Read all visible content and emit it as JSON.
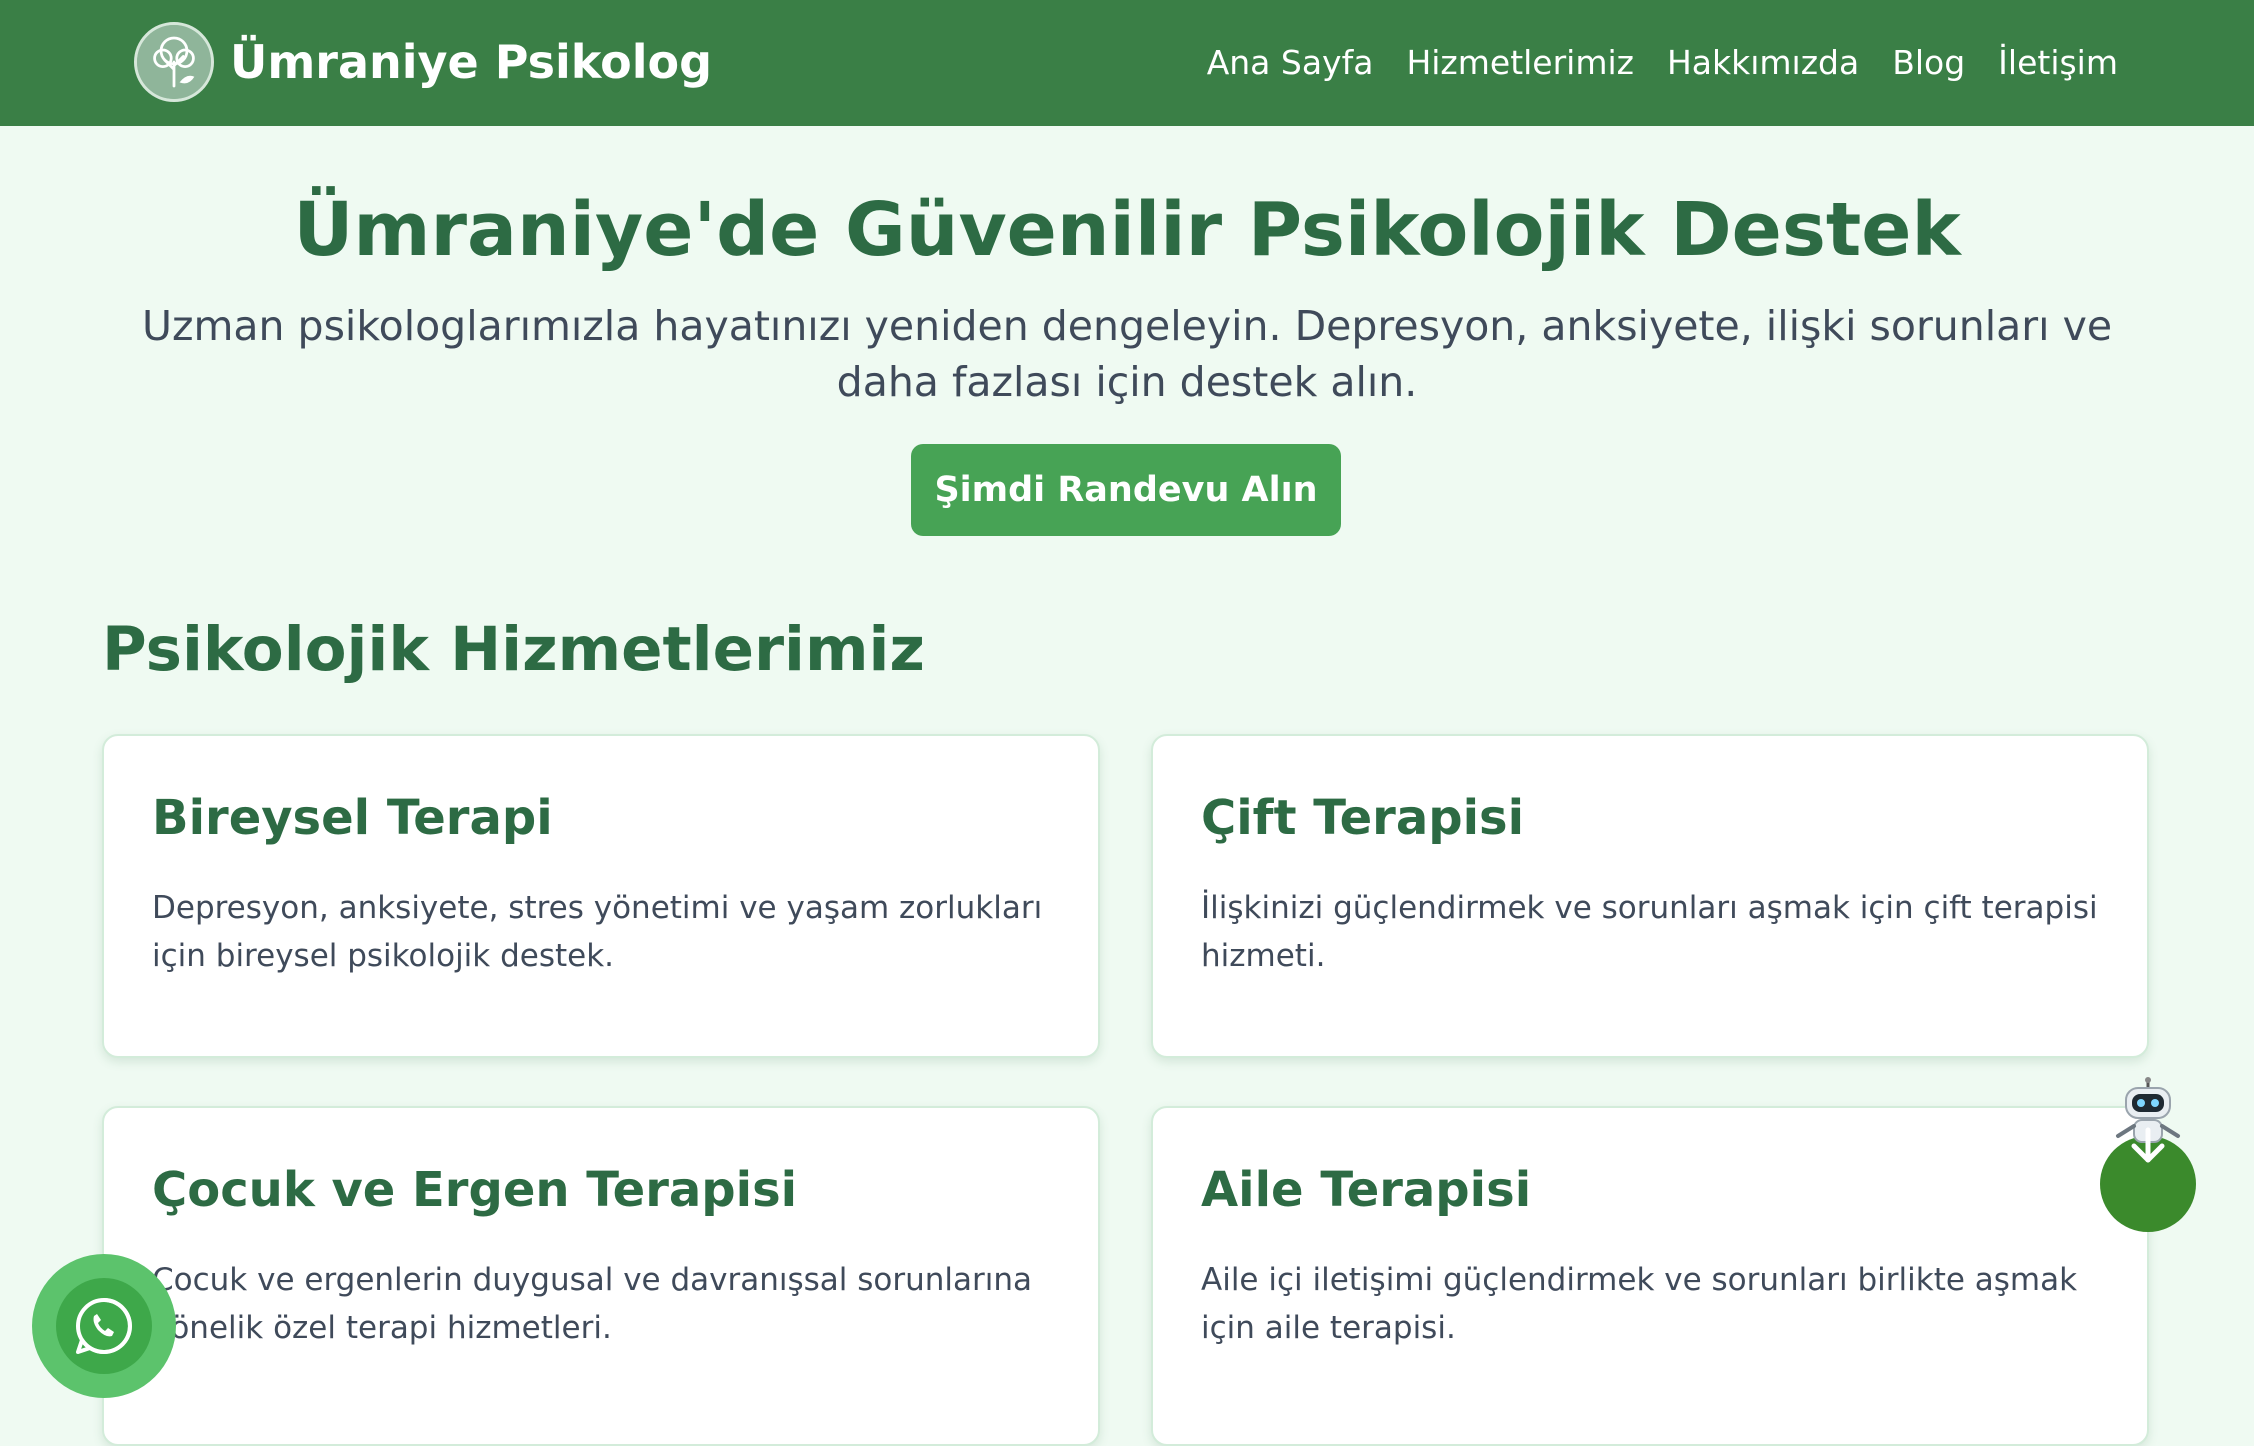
{
  "header": {
    "brand": "Ümraniye Psikolog",
    "nav": [
      "Ana Sayfa",
      "Hizmetlerimiz",
      "Hakkımızda",
      "Blog",
      "İletişim"
    ]
  },
  "hero": {
    "title": "Ümraniye'de Güvenilir Psikolojik Destek",
    "subtitle": "Uzman psikologlarımızla hayatınızı yeniden dengeleyin. Depresyon, anksiyete, ilişki sorunları ve daha fazlası için destek alın.",
    "cta": "Şimdi Randevu Alın"
  },
  "services": {
    "title": "Psikolojik Hizmetlerimiz",
    "items": [
      {
        "title": "Bireysel Terapi",
        "text": "Depresyon, anksiyete, stres yönetimi ve yaşam zorlukları için bireysel psikolojik destek."
      },
      {
        "title": "Çift Terapisi",
        "text": "İlişkinizi güçlendirmek ve sorunları aşmak için çift terapisi hizmeti."
      },
      {
        "title": "Çocuk ve Ergen Terapisi",
        "text": "Çocuk ve ergenlerin duygusal ve davranışsal sorunlarına yönelik özel terapi hizmetleri."
      },
      {
        "title": "Aile Terapisi",
        "text": "Aile içi iletişimi güçlendirmek ve sorunları birlikte aşmak için aile terapisi."
      }
    ]
  },
  "icons": {
    "logo": "tree-logo-icon",
    "chat": "robot-icon",
    "scroll": "arrow-down-icon",
    "whatsapp": "whatsapp-icon"
  },
  "colors": {
    "primary": "#3a7f46",
    "accent": "#47a355",
    "heading": "#2d6b44",
    "background": "#effaf2",
    "whatsapp": "#5cc36c"
  }
}
